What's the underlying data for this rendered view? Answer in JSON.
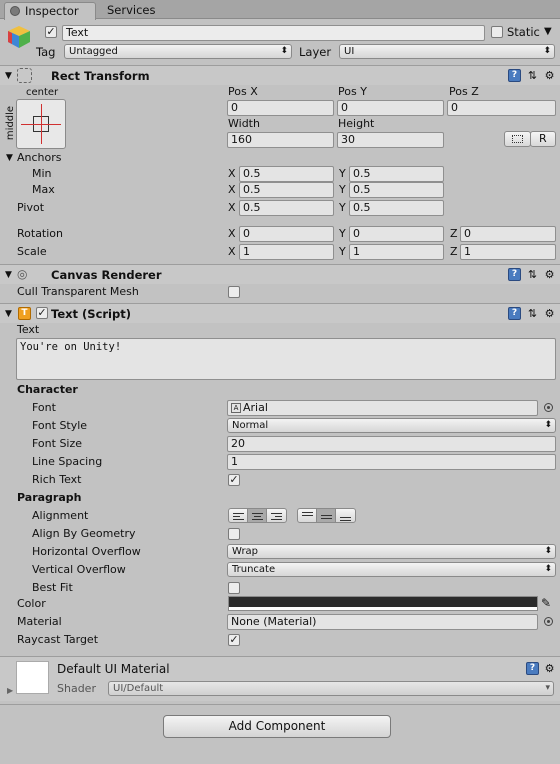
{
  "tabs": {
    "inspector": "Inspector",
    "services": "Services"
  },
  "object": {
    "name": "Text",
    "active": true,
    "static_label": "Static",
    "tag_label": "Tag",
    "tag": "Untagged",
    "layer_label": "Layer",
    "layer": "UI"
  },
  "rect_transform": {
    "title": "Rect Transform",
    "anchor_preset_h": "center",
    "anchor_preset_v": "middle",
    "pos_x_label": "Pos X",
    "pos_y_label": "Pos Y",
    "pos_z_label": "Pos Z",
    "pos_x": "0",
    "pos_y": "0",
    "pos_z": "0",
    "width_label": "Width",
    "height_label": "Height",
    "width": "160",
    "height": "30",
    "r_label": "R",
    "anchors_label": "Anchors",
    "min_label": "Min",
    "min_x": "0.5",
    "min_y": "0.5",
    "max_label": "Max",
    "max_x": "0.5",
    "max_y": "0.5",
    "pivot_label": "Pivot",
    "pivot_x": "0.5",
    "pivot_y": "0.5",
    "rotation_label": "Rotation",
    "rot_x": "0",
    "rot_y": "0",
    "rot_z": "0",
    "scale_label": "Scale",
    "scale_x": "1",
    "scale_y": "1",
    "scale_z": "1",
    "x": "X",
    "y": "Y",
    "z": "Z"
  },
  "canvas_renderer": {
    "title": "Canvas Renderer",
    "cull_label": "Cull Transparent Mesh",
    "cull": false
  },
  "text_script": {
    "title": "Text (Script)",
    "text_label": "Text",
    "text_value": "You're on Unity!",
    "character_label": "Character",
    "font_label": "Font",
    "font": "Arial",
    "font_style_label": "Font Style",
    "font_style": "Normal",
    "font_size_label": "Font Size",
    "font_size": "20",
    "line_spacing_label": "Line Spacing",
    "line_spacing": "1",
    "rich_text_label": "Rich Text",
    "rich_text": true,
    "paragraph_label": "Paragraph",
    "alignment_label": "Alignment",
    "align_geometry_label": "Align By Geometry",
    "h_overflow_label": "Horizontal Overflow",
    "h_overflow": "Wrap",
    "v_overflow_label": "Vertical Overflow",
    "v_overflow": "Truncate",
    "best_fit_label": "Best Fit",
    "color_label": "Color",
    "color": "#2b2b2b",
    "material_label": "Material",
    "material": "None (Material)",
    "raycast_label": "Raycast Target",
    "raycast": true
  },
  "material_panel": {
    "name": "Default UI Material",
    "shader_label": "Shader",
    "shader": "UI/Default"
  },
  "add_component": "Add Component",
  "icons": [
    "gameobject-cube-icon",
    "rect-transform-icon",
    "canvas-renderer-icon",
    "text-component-icon",
    "help-icon",
    "preset-icon",
    "settings-gear-icon",
    "eyedropper-icon",
    "object-picker-icon",
    "dropdown-arrow-icon"
  ]
}
